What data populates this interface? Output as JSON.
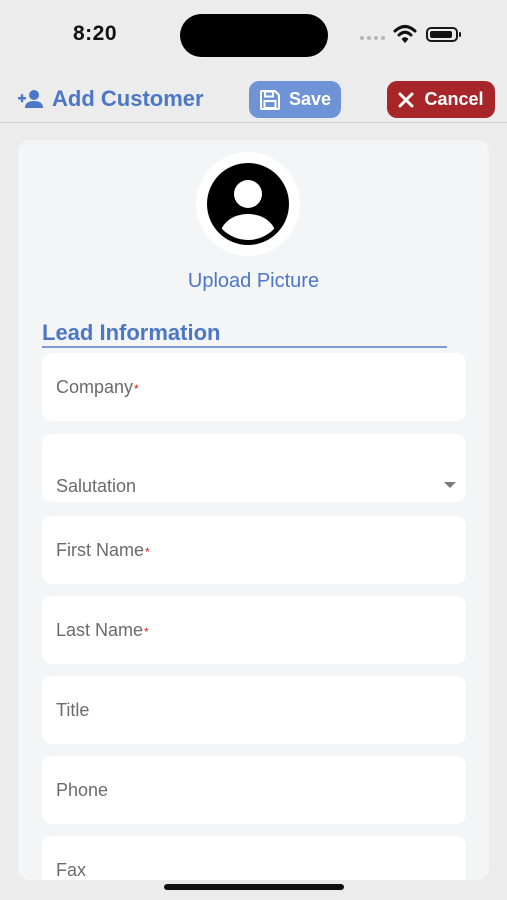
{
  "status_bar": {
    "time": "8:20"
  },
  "header": {
    "title": "Add Customer",
    "save_label": "Save",
    "cancel_label": "Cancel"
  },
  "profile": {
    "upload_label": "Upload Picture"
  },
  "section": {
    "title": "Lead Information"
  },
  "fields": [
    {
      "label": "Company",
      "required": "*"
    },
    {
      "label": "Salutation",
      "type": "dropdown"
    },
    {
      "label": "First Name",
      "required": "*"
    },
    {
      "label": "Last Name",
      "required": "*"
    },
    {
      "label": "Title"
    },
    {
      "label": "Phone"
    },
    {
      "label": "Fax"
    }
  ],
  "colors": {
    "accent": "#4c76c8",
    "save_bg": "#6f93d7",
    "cancel_bg": "#a8262a",
    "required": "#e01919"
  },
  "icons": {
    "title": "add-person-icon",
    "save": "floppy-disk-icon",
    "cancel": "close-icon",
    "avatar": "user-avatar-icon",
    "dropdown": "caret-down-icon"
  }
}
